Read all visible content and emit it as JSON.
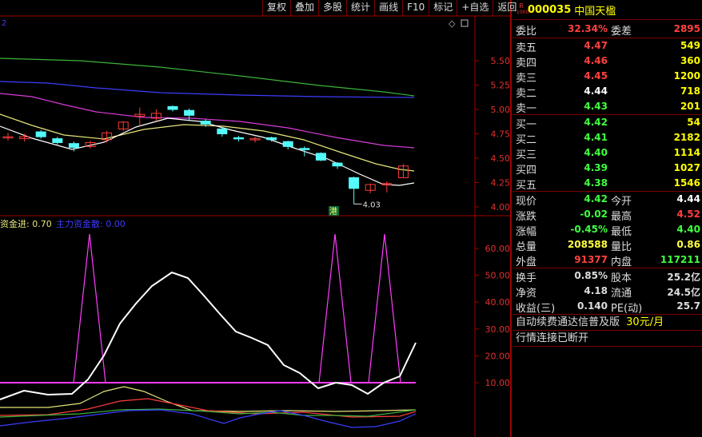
{
  "toolbar": {
    "items": [
      "复权",
      "叠加",
      "多股",
      "统计",
      "画线",
      "F10",
      "标记",
      "+自选",
      "返回"
    ]
  },
  "chart": {
    "corner_label": "2",
    "diamond_glyph": "◇",
    "price_axis": [
      "5.50",
      "5.25",
      "5.00",
      "4.75",
      "4.50",
      "4.25",
      "4.00"
    ],
    "low_marker": "4.03",
    "hk_badge": "港",
    "indicator_label_1": "资金进: 0.70",
    "indicator_label_2": "主力资金散: 0.00",
    "indicator_axis": [
      "60.00",
      "50.00",
      "40.00",
      "30.00",
      "20.00",
      "10.00"
    ],
    "colors": {
      "up": "#ff3c3c",
      "down": "#54fcfc",
      "ma_white": "#ffffff",
      "ma_yellow": "#e6e67a",
      "ma_magenta": "#d83cd8",
      "ma_green": "#3cb43c",
      "ma_blue": "#3c3cff",
      "spike": "#ff3cff",
      "frame": "#a00000"
    },
    "candles": [
      {
        "o": 4.72,
        "c": 4.72,
        "h": 4.76,
        "l": 4.68
      },
      {
        "o": 4.7,
        "c": 4.72,
        "h": 4.75,
        "l": 4.67
      },
      {
        "o": 4.77,
        "c": 4.72,
        "h": 4.79,
        "l": 4.7
      },
      {
        "o": 4.7,
        "c": 4.66,
        "h": 4.72,
        "l": 4.64
      },
      {
        "o": 4.65,
        "c": 4.61,
        "h": 4.67,
        "l": 4.57
      },
      {
        "o": 4.62,
        "c": 4.66,
        "h": 4.68,
        "l": 4.6
      },
      {
        "o": 4.69,
        "c": 4.76,
        "h": 4.78,
        "l": 4.66
      },
      {
        "o": 4.8,
        "c": 4.87,
        "h": 4.88,
        "l": 4.78
      },
      {
        "o": 4.93,
        "c": 4.95,
        "h": 5.02,
        "l": 4.83
      },
      {
        "o": 4.91,
        "c": 4.96,
        "h": 5.0,
        "l": 4.88
      },
      {
        "o": 5.03,
        "c": 5.0,
        "h": 5.04,
        "l": 4.98
      },
      {
        "o": 4.99,
        "c": 4.94,
        "h": 5.01,
        "l": 4.88
      },
      {
        "o": 4.88,
        "c": 4.85,
        "h": 4.9,
        "l": 4.82
      },
      {
        "o": 4.8,
        "c": 4.75,
        "h": 4.82,
        "l": 4.72
      },
      {
        "o": 4.71,
        "c": 4.7,
        "h": 4.73,
        "l": 4.67
      },
      {
        "o": 4.7,
        "c": 4.7,
        "h": 4.72,
        "l": 4.66
      },
      {
        "o": 4.71,
        "c": 4.69,
        "h": 4.72,
        "l": 4.67
      },
      {
        "o": 4.67,
        "c": 4.62,
        "h": 4.68,
        "l": 4.59
      },
      {
        "o": 4.6,
        "c": 4.59,
        "h": 4.62,
        "l": 4.52
      },
      {
        "o": 4.55,
        "c": 4.48,
        "h": 4.56,
        "l": 4.47
      },
      {
        "o": 4.45,
        "c": 4.42,
        "h": 4.46,
        "l": 4.39
      },
      {
        "o": 4.3,
        "c": 4.19,
        "h": 4.31,
        "l": 4.03
      },
      {
        "o": 4.17,
        "c": 4.23,
        "h": 4.24,
        "l": 4.14
      },
      {
        "o": 4.24,
        "c": 4.24,
        "h": 4.26,
        "l": 4.15
      },
      {
        "o": 4.3,
        "c": 4.42,
        "h": 4.44,
        "l": 4.3
      }
    ]
  },
  "panel": {
    "badge_r": "R",
    "badge_sub": "1000",
    "code": "000035",
    "name": "中国天楹",
    "weibi": {
      "label": "委比",
      "value": "32.34%",
      "label2": "委差",
      "value2": "2895"
    },
    "sells": [
      {
        "label": "卖五",
        "price": "4.47",
        "vol": "549",
        "color": "#ff4040"
      },
      {
        "label": "卖四",
        "price": "4.46",
        "vol": "360",
        "color": "#ff4040"
      },
      {
        "label": "卖三",
        "price": "4.45",
        "vol": "1200",
        "color": "#ff4040"
      },
      {
        "label": "卖二",
        "price": "4.44",
        "vol": "718",
        "color": "#ffffff"
      },
      {
        "label": "卖一",
        "price": "4.43",
        "vol": "201",
        "color": "#40ff40"
      }
    ],
    "buys": [
      {
        "label": "买一",
        "price": "4.42",
        "vol": "54",
        "color": "#40ff40"
      },
      {
        "label": "买二",
        "price": "4.41",
        "vol": "2182",
        "color": "#40ff40"
      },
      {
        "label": "买三",
        "price": "4.40",
        "vol": "1114",
        "color": "#40ff40"
      },
      {
        "label": "买四",
        "price": "4.39",
        "vol": "1027",
        "color": "#40ff40"
      },
      {
        "label": "买五",
        "price": "4.38",
        "vol": "1546",
        "color": "#40ff40"
      }
    ],
    "stats1": [
      {
        "l1": "现价",
        "v1": "4.42",
        "c1": "#40ff40",
        "l2": "今开",
        "v2": "4.44",
        "c2": "#ffffff"
      },
      {
        "l1": "涨跌",
        "v1": "-0.02",
        "c1": "#40ff40",
        "l2": "最高",
        "v2": "4.52",
        "c2": "#ff4040"
      },
      {
        "l1": "涨幅",
        "v1": "-0.45%",
        "c1": "#40ff40",
        "l2": "最低",
        "v2": "4.40",
        "c2": "#40ff40"
      },
      {
        "l1": "总量",
        "v1": "208588",
        "c1": "#ffff40",
        "l2": "量比",
        "v2": "0.86",
        "c2": "#ffff40"
      },
      {
        "l1": "外盘",
        "v1": "91377",
        "c1": "#ff4040",
        "l2": "内盘",
        "v2": "117211",
        "c2": "#40ff40"
      }
    ],
    "stats2": [
      {
        "l1": "换手",
        "v1": "0.85%",
        "c1": "#dddddd",
        "l2": "股本",
        "v2": "25.2亿",
        "c2": "#dddddd"
      },
      {
        "l1": "净资",
        "v1": "4.18",
        "c1": "#dddddd",
        "l2": "流通",
        "v2": "24.5亿",
        "c2": "#dddddd"
      },
      {
        "l1": "收益(三)",
        "v1": "0.140",
        "c1": "#dddddd",
        "l2": "PE(动)",
        "v2": "25.7",
        "c2": "#dddddd"
      }
    ],
    "promo_text": "自动续费通达信普及版",
    "promo_price": "30元/月",
    "status_text": "行情连接已断开"
  }
}
